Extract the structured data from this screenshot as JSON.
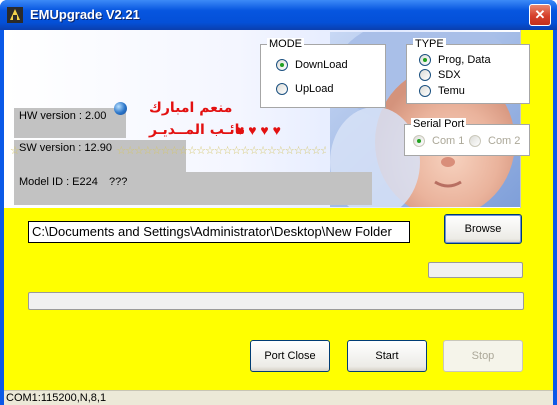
{
  "window": {
    "title": "EMUpgrade V2.21",
    "close_glyph": "✕"
  },
  "info": {
    "hw_version": "HW version : 2.00",
    "sw_version": "SW version : 12.90",
    "model_id": "Model ID : E224",
    "model_unknown": "???",
    "arabic_line1": "منعم امبارك",
    "arabic_line2": "نائـب المــديـر",
    "hearts": "♥ ♥ ♥ ♥",
    "stars": "☆☆☆☆☆☆☆☆☆☆☆☆☆☆☆☆☆☆☆☆☆☆☆☆☆☆☆☆☆☆☆☆☆☆☆☆☆☆☆☆"
  },
  "mode": {
    "legend": "MODE",
    "options": [
      {
        "label": "DownLoad",
        "checked": true
      },
      {
        "label": "UpLoad",
        "checked": false
      }
    ]
  },
  "type": {
    "legend": "TYPE",
    "options": [
      {
        "label": "Prog, Data",
        "checked": true
      },
      {
        "label": "SDX",
        "checked": false
      },
      {
        "label": "Temu",
        "checked": false
      }
    ]
  },
  "serial_port": {
    "legend": "Serial Port",
    "options": [
      {
        "label": "Com 1",
        "checked": true,
        "disabled": true
      },
      {
        "label": "Com 2",
        "checked": false,
        "disabled": true
      }
    ]
  },
  "path": {
    "value": "C:\\Documents and Settings\\Administrator\\Desktop\\New Folder"
  },
  "buttons": {
    "browse": "Browse",
    "port_close": "Port Close",
    "start": "Start",
    "stop": "Stop"
  },
  "progress": {
    "small": 0,
    "main": 0
  },
  "status": {
    "text": "COM1:115200,N,8,1"
  },
  "colors": {
    "client_bg": "#ffff00",
    "titlebar": "#0756e0",
    "accent_red": "#e31010"
  },
  "icons": {
    "app": "app-icon",
    "close": "close-icon",
    "globe": "globe-icon"
  }
}
